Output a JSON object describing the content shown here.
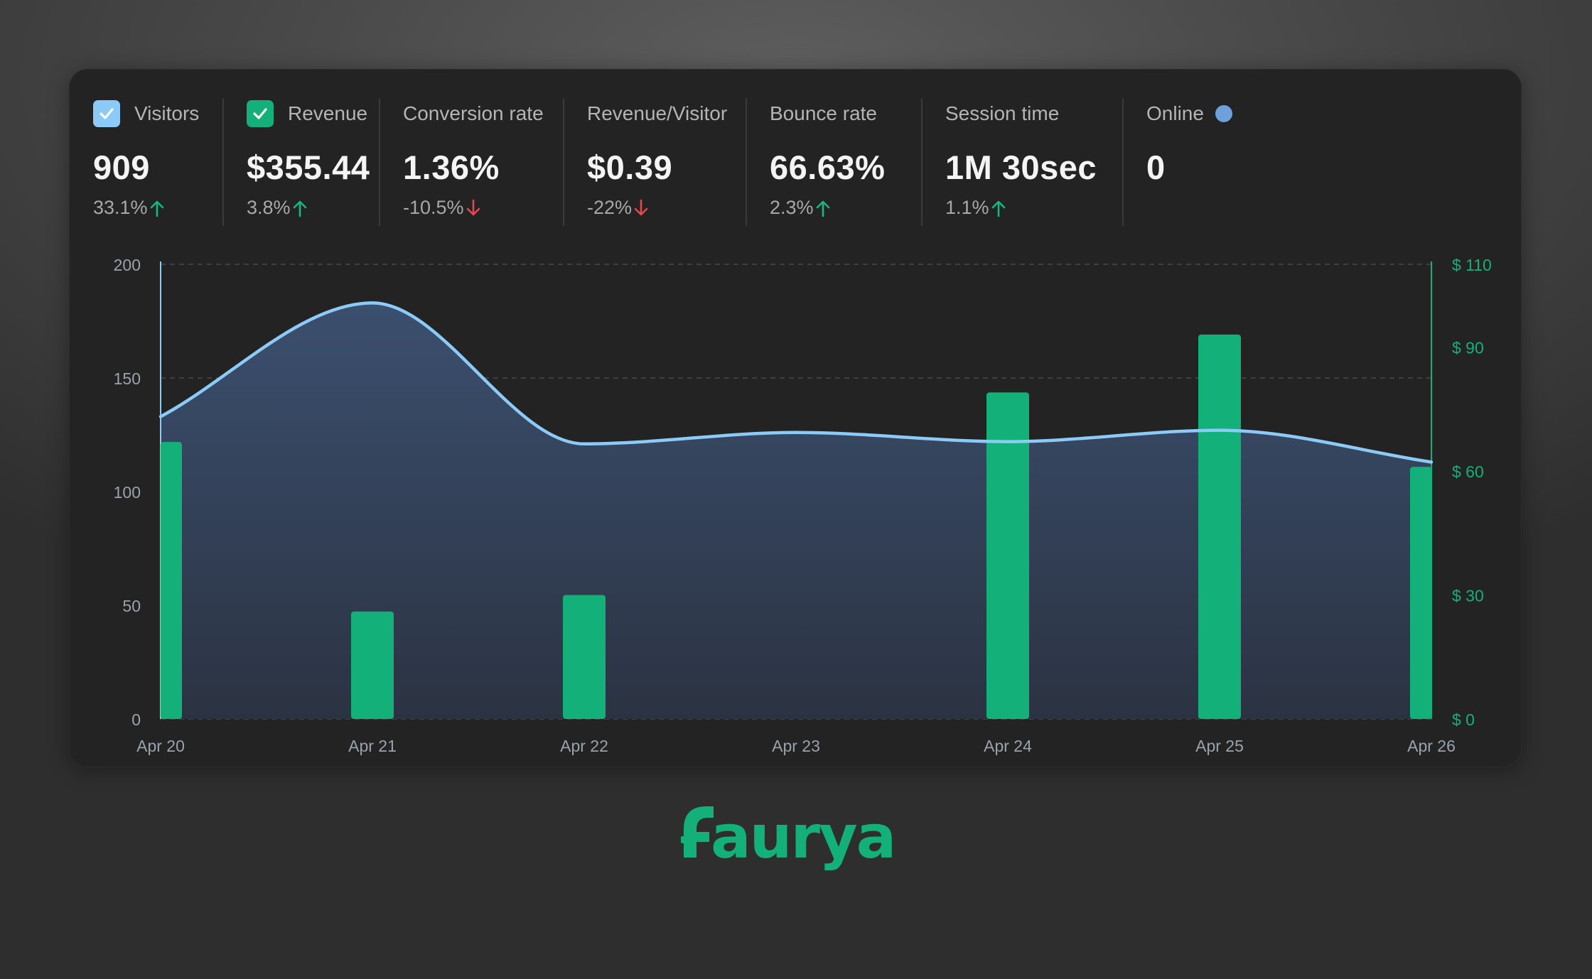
{
  "metrics": [
    {
      "label": "Visitors",
      "value": "909",
      "change": "33.1%",
      "trend": "up",
      "checkbox": true,
      "checkbox_color": "#8ccaf7"
    },
    {
      "label": "Revenue",
      "value": "$355.44",
      "change": "3.8%",
      "trend": "up",
      "checkbox": true,
      "checkbox_color": "#14b07a"
    },
    {
      "label": "Conversion rate",
      "value": "1.36%",
      "change": "-10.5%",
      "trend": "down"
    },
    {
      "label": "Revenue/Visitor",
      "value": "$0.39",
      "change": "-22%",
      "trend": "down"
    },
    {
      "label": "Bounce rate",
      "value": "66.63%",
      "change": "2.3%",
      "trend": "up"
    },
    {
      "label": "Session time",
      "value": "1M 30sec",
      "change": "1.1%",
      "trend": "up"
    },
    {
      "label": "Online",
      "value": "0",
      "status_dot_color": "#6fa0dc"
    }
  ],
  "colors": {
    "up": "#17b87f",
    "down": "#e5484d",
    "visitors_line": "#8ccaf7",
    "revenue_bar": "#14b07a",
    "grid": "#4a4a4a",
    "axis_text": "#9aa3ad"
  },
  "chart_data": {
    "type": "bar+area",
    "categories": [
      "Apr 20",
      "Apr 21",
      "Apr 22",
      "Apr 23",
      "Apr 24",
      "Apr 25",
      "Apr 26"
    ],
    "series": [
      {
        "name": "Visitors",
        "type": "area",
        "axis": "left",
        "values": [
          133,
          183,
          121,
          126,
          122,
          127,
          113
        ]
      },
      {
        "name": "Revenue",
        "type": "bar",
        "axis": "right",
        "values": [
          67,
          26,
          30,
          0,
          79,
          93,
          61
        ]
      }
    ],
    "y_left": {
      "ticks": [
        0,
        50,
        100,
        150,
        200
      ],
      "tick_labels": [
        "0",
        "50",
        "100",
        "150",
        "200"
      ],
      "range": [
        0,
        200
      ]
    },
    "y_right": {
      "ticks": [
        0,
        30,
        60,
        90,
        110
      ],
      "tick_labels": [
        "$ 0",
        "$ 30",
        "$ 60",
        "$ 90",
        "$ 110"
      ],
      "range": [
        0,
        110
      ]
    },
    "grid": true
  },
  "brand": {
    "name": "faurya",
    "color": "#14b07a"
  }
}
